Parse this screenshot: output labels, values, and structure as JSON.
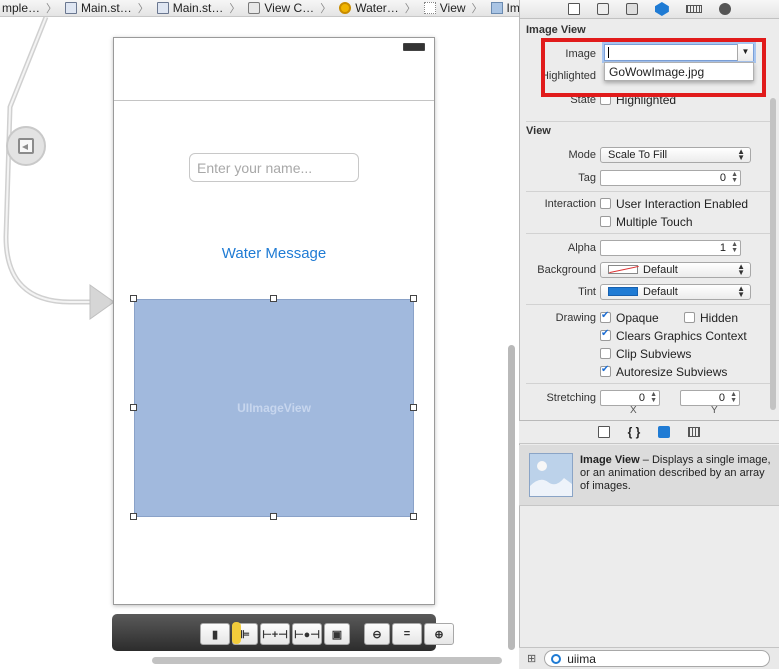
{
  "breadcrumb": [
    {
      "label": "mple…",
      "icon": "folder-icon"
    },
    {
      "label": "Main.st…",
      "icon": "storyboard-icon"
    },
    {
      "label": "Main.st…",
      "icon": "storyboard-icon"
    },
    {
      "label": "View C…",
      "icon": "view-controller-icon"
    },
    {
      "label": "Water…",
      "icon": "water-scene-icon"
    },
    {
      "label": "View",
      "icon": "view-icon"
    },
    {
      "label": "Image View",
      "icon": "image-view-icon"
    }
  ],
  "canvas": {
    "name_placeholder": "Enter your name...",
    "water_message": "Water Message",
    "image_view_label": "UIImageView"
  },
  "inspector": {
    "image_view_section": "Image View",
    "image_label": "Image",
    "image_value": "",
    "image_suggestion": "GoWowImage.jpg",
    "highlighted_label": "Highlighted",
    "state_label": "State",
    "state_option": "Highlighted",
    "view_section": "View",
    "mode_label": "Mode",
    "mode_value": "Scale To Fill",
    "tag_label": "Tag",
    "tag_value": "0",
    "interaction_label": "Interaction",
    "user_interaction": "User Interaction Enabled",
    "multiple_touch": "Multiple Touch",
    "alpha_label": "Alpha",
    "alpha_value": "1",
    "background_label": "Background",
    "background_value": "Default",
    "tint_label": "Tint",
    "tint_value": "Default",
    "drawing_label": "Drawing",
    "opaque": "Opaque",
    "hidden": "Hidden",
    "clears_graphics": "Clears Graphics Context",
    "clip_subviews": "Clip Subviews",
    "autoresize_subviews": "Autoresize Subviews",
    "stretching_label": "Stretching",
    "stretch_x_value": "0",
    "stretch_y_value": "0",
    "x_caption": "X",
    "y_caption": "Y"
  },
  "library": {
    "item_title": "Image View",
    "item_desc": " – Displays a single image, or an animation described by an array of images.",
    "filter_value": "uiima"
  },
  "colors": {
    "accent": "#1f7bd4",
    "highlight_box": "#e11b1b",
    "image_view_fill": "#a1b9dd"
  }
}
